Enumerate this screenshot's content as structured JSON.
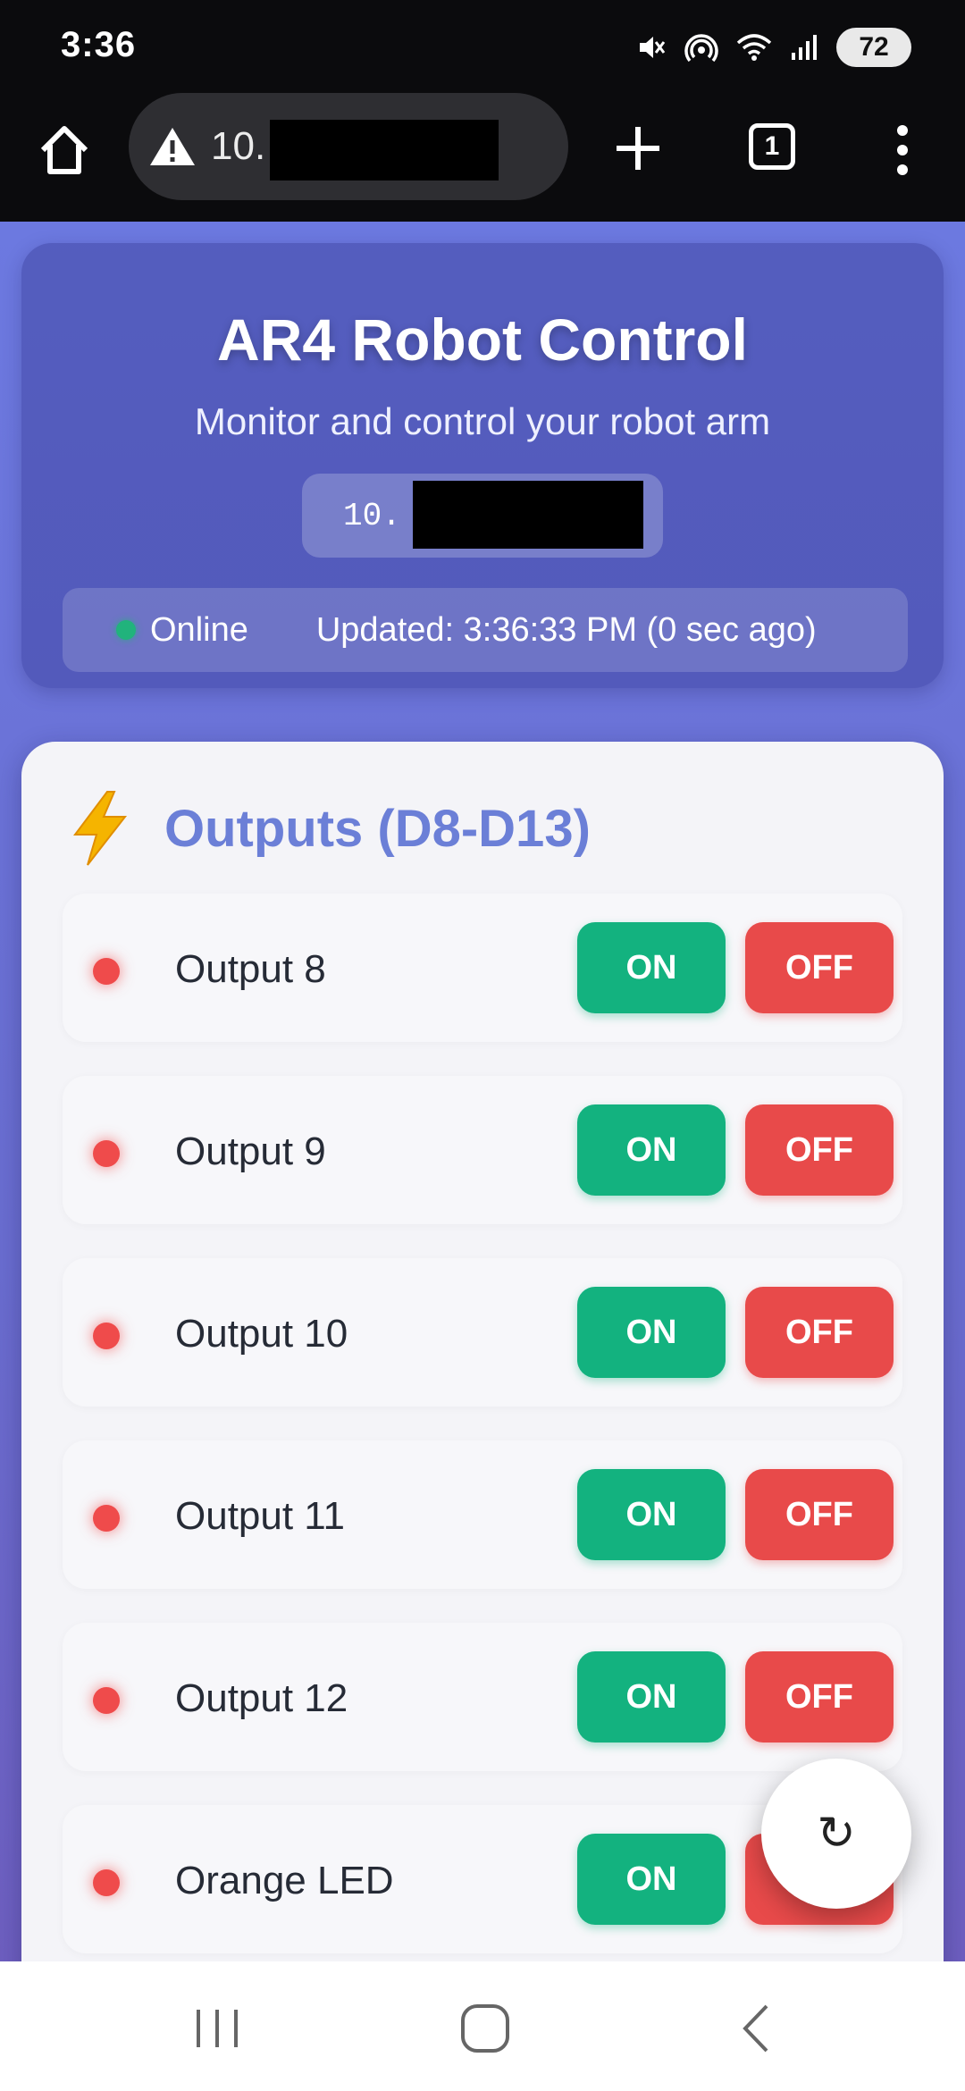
{
  "status_bar": {
    "time": "3:36",
    "battery": "72",
    "icons": [
      "mute-icon",
      "hotspot-icon",
      "wifi-icon",
      "signal-icon",
      "battery-icon"
    ]
  },
  "browser": {
    "url": "10.",
    "tab_count": "1",
    "icons": [
      "home-icon",
      "warning-icon",
      "plus-icon",
      "menu-dots-icon"
    ]
  },
  "hero": {
    "title": "AR4 Robot Control",
    "subtitle": "Monitor and control your robot arm",
    "ip": "10.",
    "status": "Online",
    "updated": "Updated: 3:36:33 PM (0 sec ago)"
  },
  "outputs": {
    "icon": "lightning-icon",
    "title": "Outputs (D8-D13)",
    "on_label": "ON",
    "off_label": "OFF",
    "items": [
      {
        "label": "Output 8"
      },
      {
        "label": "Output 9"
      },
      {
        "label": "Output 10"
      },
      {
        "label": "Output 11"
      },
      {
        "label": "Output 12"
      },
      {
        "label": "Orange LED"
      }
    ]
  },
  "fab": {
    "refresh": "↻"
  },
  "colors": {
    "accent": "#6b7fd7",
    "on": "#13b27f",
    "off": "#e84a4a",
    "led_off": "#ef4b4b",
    "online": "#21b37c"
  }
}
